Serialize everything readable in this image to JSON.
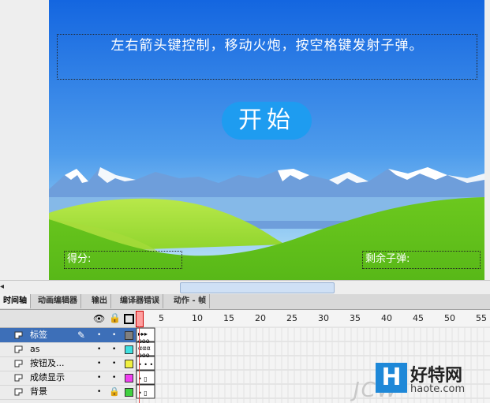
{
  "stage": {
    "instruction": "左右箭头键控制，移动火炮，按空格键发射子弹。",
    "start_button": "开始",
    "score_label": "得分:",
    "ammo_label": "剩余子弹:",
    "colors": {
      "sky_top": "#1a6ee6",
      "sky_bottom": "#a8d8f6",
      "grass": "#7ccf2a",
      "button": "#1e9cf0"
    }
  },
  "panel_tabs": [
    "时间轴",
    "动画编辑器",
    "输出",
    "编译器错误",
    "动作 - 帧"
  ],
  "ruler": [
    "5",
    "10",
    "15",
    "20",
    "25",
    "30",
    "35",
    "40",
    "45",
    "50",
    "55"
  ],
  "layers": [
    {
      "name": "标签",
      "selected": true,
      "color": "#808080"
    },
    {
      "name": "as",
      "selected": false,
      "color": "#3fe0e0"
    },
    {
      "name": "按钮及...",
      "selected": false,
      "color": "#f0f040"
    },
    {
      "name": "成绩显示",
      "selected": false,
      "color": "#f040f0"
    },
    {
      "name": "背景",
      "selected": false,
      "color": "#40d040"
    }
  ],
  "watermark": {
    "brand": "好特网",
    "url": "haote.com",
    "logo": "H",
    "faint": "JCW"
  }
}
